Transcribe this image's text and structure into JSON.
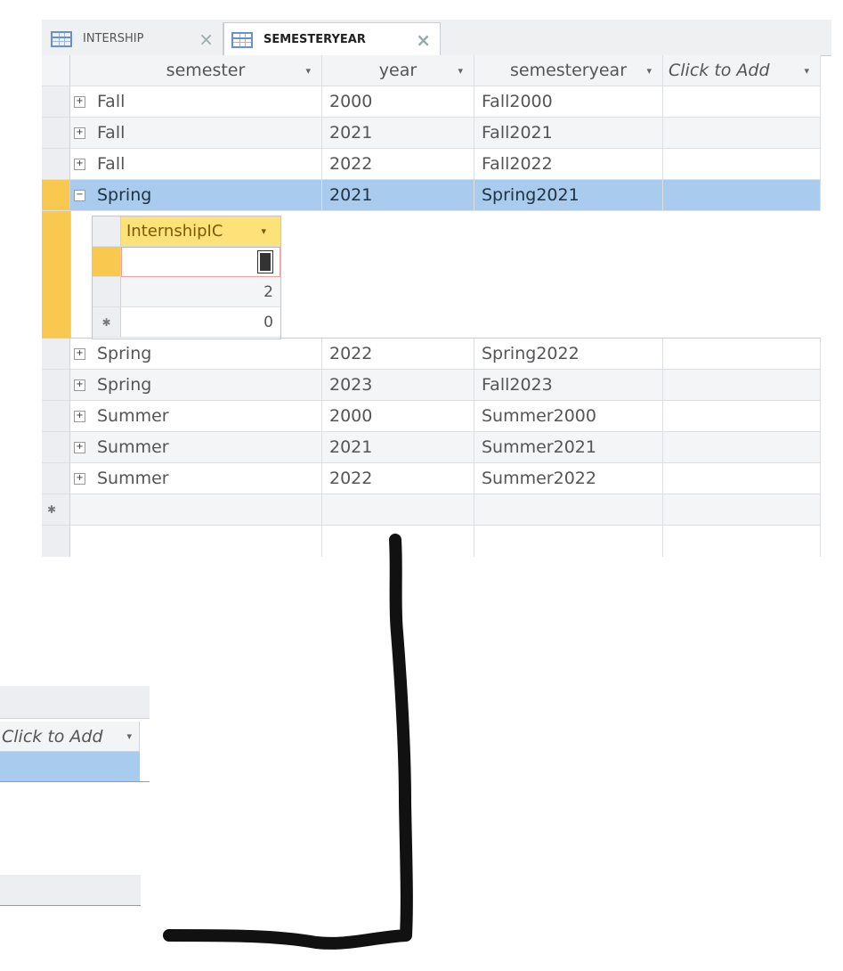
{
  "tabs": [
    {
      "label": "INTERSHIP",
      "active": false
    },
    {
      "label": "SEMESTERYEAR",
      "active": true
    }
  ],
  "columns": [
    "semester",
    "year",
    "semesteryear",
    "Click to Add"
  ],
  "rows": [
    {
      "semester": "Fall",
      "year": "2000",
      "semesteryear": "Fall2000"
    },
    {
      "semester": "Fall",
      "year": "2021",
      "semesteryear": "Fall2021"
    },
    {
      "semester": "Fall",
      "year": "2022",
      "semesteryear": "Fall2022"
    },
    {
      "semester": "Spring",
      "year": "2021",
      "semesteryear": "Spring2021"
    },
    {
      "semester": "Spring",
      "year": "2022",
      "semesteryear": "Spring2022"
    },
    {
      "semester": "Spring",
      "year": "2023",
      "semesteryear": "Fall2023"
    },
    {
      "semester": "Summer",
      "year": "2000",
      "semesteryear": "Summer2000"
    },
    {
      "semester": "Summer",
      "year": "2021",
      "semesteryear": "Summer2021"
    },
    {
      "semester": "Summer",
      "year": "2022",
      "semesteryear": "Summer2022"
    }
  ],
  "subdatasheet": {
    "column": "InternshipIC",
    "values": [
      "",
      "2",
      "0"
    ]
  },
  "lower_panel": {
    "column": "Click to Add"
  },
  "glyphs": {
    "expand": "+",
    "collapse": "−",
    "new_record": "✱",
    "dropdown": "▾",
    "close": "×"
  },
  "colors": {
    "selected_row": "#a8cbee",
    "record_selector_active": "#f9c94f",
    "sub_header": "#fde27a",
    "annotation_stroke": "#111111"
  }
}
